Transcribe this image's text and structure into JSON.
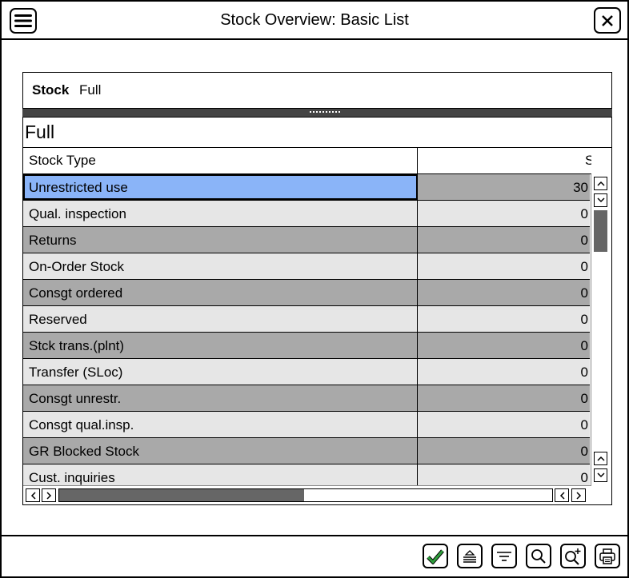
{
  "window": {
    "title": "Stock Overview: Basic List",
    "icons": {
      "menu": "hamburger-menu-icon",
      "close": "close-x-icon"
    }
  },
  "stock_info": {
    "label": "Stock",
    "value": "Full"
  },
  "panel": {
    "title": "Full",
    "columns": {
      "stock_type": "Stock Type",
      "qty": "S"
    },
    "rows": [
      {
        "type": "Unrestricted use",
        "qty": "30"
      },
      {
        "type": "Qual. inspection",
        "qty": "0"
      },
      {
        "type": "Returns",
        "qty": "0"
      },
      {
        "type": "On-Order Stock",
        "qty": "0"
      },
      {
        "type": "Consgt ordered",
        "qty": "0"
      },
      {
        "type": "Reserved",
        "qty": "0"
      },
      {
        "type": "Stck trans.(plnt)",
        "qty": "0"
      },
      {
        "type": "Transfer (SLoc)",
        "qty": "0"
      },
      {
        "type": "Consgt unrestr.",
        "qty": "0"
      },
      {
        "type": "Consgt qual.insp.",
        "qty": "0"
      },
      {
        "type": "GR Blocked Stock",
        "qty": "0"
      },
      {
        "type": "Cust. inquiries",
        "qty": "0"
      }
    ],
    "selected_row": 0
  },
  "colors": {
    "selected": "#8ab4f8",
    "row_light": "#e6e6e6",
    "row_dark": "#a9a9a9",
    "confirm_check": "#2e9e3c"
  },
  "toolbar": {
    "buttons": [
      {
        "name": "confirm-button",
        "icon": "checkmark-icon"
      },
      {
        "name": "expand-button",
        "icon": "expand-icon"
      },
      {
        "name": "filter-button",
        "icon": "filter-icon"
      },
      {
        "name": "find-button",
        "icon": "search-icon"
      },
      {
        "name": "find-next-button",
        "icon": "search-plus-icon"
      },
      {
        "name": "print-button",
        "icon": "printer-icon"
      }
    ]
  }
}
